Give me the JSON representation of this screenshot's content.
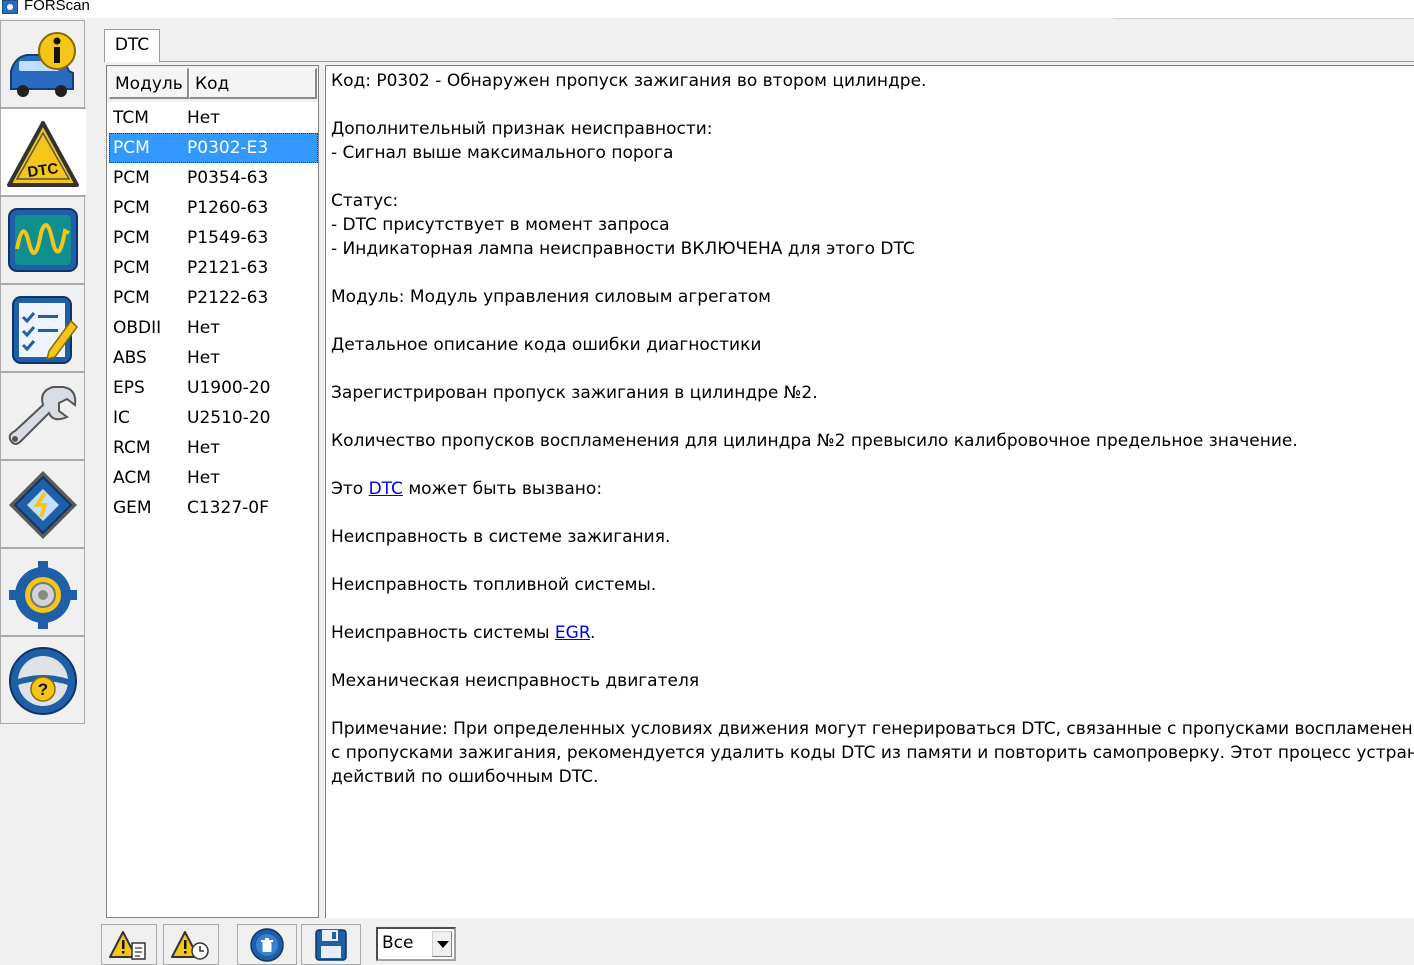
{
  "window": {
    "title": "FORScan"
  },
  "sidebar": {
    "items": [
      {
        "icon": "vehicle-info-icon",
        "active": false
      },
      {
        "icon": "dtc-warning-icon",
        "active": true
      },
      {
        "icon": "oscilloscope-icon",
        "active": false
      },
      {
        "icon": "checklist-icon",
        "active": false
      },
      {
        "icon": "wrench-icon",
        "active": false
      },
      {
        "icon": "chip-icon",
        "active": false
      },
      {
        "icon": "settings-gear-icon",
        "active": false
      },
      {
        "icon": "help-wheel-icon",
        "active": false
      }
    ]
  },
  "tabs": [
    {
      "label": "DTC"
    }
  ],
  "dtc_list": {
    "header": {
      "module": "Модуль",
      "code": "Код"
    },
    "rows": [
      {
        "module": "TCM",
        "code": "Нет"
      },
      {
        "module": "PCM",
        "code": "P0302-E3",
        "selected": true
      },
      {
        "module": "PCM",
        "code": "P0354-63"
      },
      {
        "module": "PCM",
        "code": "P1260-63"
      },
      {
        "module": "PCM",
        "code": "P1549-63"
      },
      {
        "module": "PCM",
        "code": "P2121-63"
      },
      {
        "module": "PCM",
        "code": "P2122-63"
      },
      {
        "module": "OBDII",
        "code": "Нет"
      },
      {
        "module": "ABS",
        "code": "Нет"
      },
      {
        "module": "EPS",
        "code": "U1900-20"
      },
      {
        "module": "IC",
        "code": "U2510-20"
      },
      {
        "module": "RCM",
        "code": "Нет"
      },
      {
        "module": "ACM",
        "code": "Нет"
      },
      {
        "module": "GEM",
        "code": "C1327-0F"
      }
    ]
  },
  "description": {
    "code_line": "Код: P0302 - Обнаружен пропуск зажигания во втором цилиндре.",
    "additional_title": "Дополнительный признак неисправности:",
    "additional_item": " - Сигнал выше максимального порога",
    "status_title": "Статус:",
    "status_item_1": " - DTC присутствует в момент запроса",
    "status_item_2": " - Индикаторная лампа неисправности ВКЛЮЧЕНА для этого DTC",
    "module_line": "Модуль: Модуль управления силовым агрегатом",
    "detail_title": "Детальное описание кода ошибки диагностики",
    "detail_1": "Зарегистрирован пропуск зажигания в цилиндре №2.",
    "detail_2": "Количество пропусков воспламенения для цилиндра №2 превысило калибровочное предельное значение.",
    "cause_prefix": "Это ",
    "cause_link": "DTC",
    "cause_suffix": " может быть вызвано:",
    "cause_1": "Неисправность в системе зажигания.",
    "cause_2": "Неисправность топливной системы.",
    "cause_3_prefix": "Неисправность системы ",
    "cause_3_link": "EGR",
    "cause_3_suffix": ".",
    "cause_4": "Механическая неисправность двигателя",
    "note_1": "Примечание: При определенных условиях движения могут генерироваться DTC, связанные с пропусками воспламенения",
    "note_2": "с пропусками зажигания, рекомендуется удалить коды DTC из памяти и повторить самопроверку. Этот процесс устраняет",
    "note_3": "действий по ошибочным DTC."
  },
  "bottom_toolbar": {
    "buttons": [
      {
        "icon": "warning-document-icon"
      },
      {
        "icon": "warning-clock-icon"
      },
      {
        "icon": "clear-dtc-icon"
      },
      {
        "icon": "save-floppy-icon"
      }
    ],
    "filter": {
      "value": "Все"
    }
  },
  "colors": {
    "selection": "#3399ff",
    "link": "#0000ee",
    "window_bg": "#f0f0f0"
  }
}
